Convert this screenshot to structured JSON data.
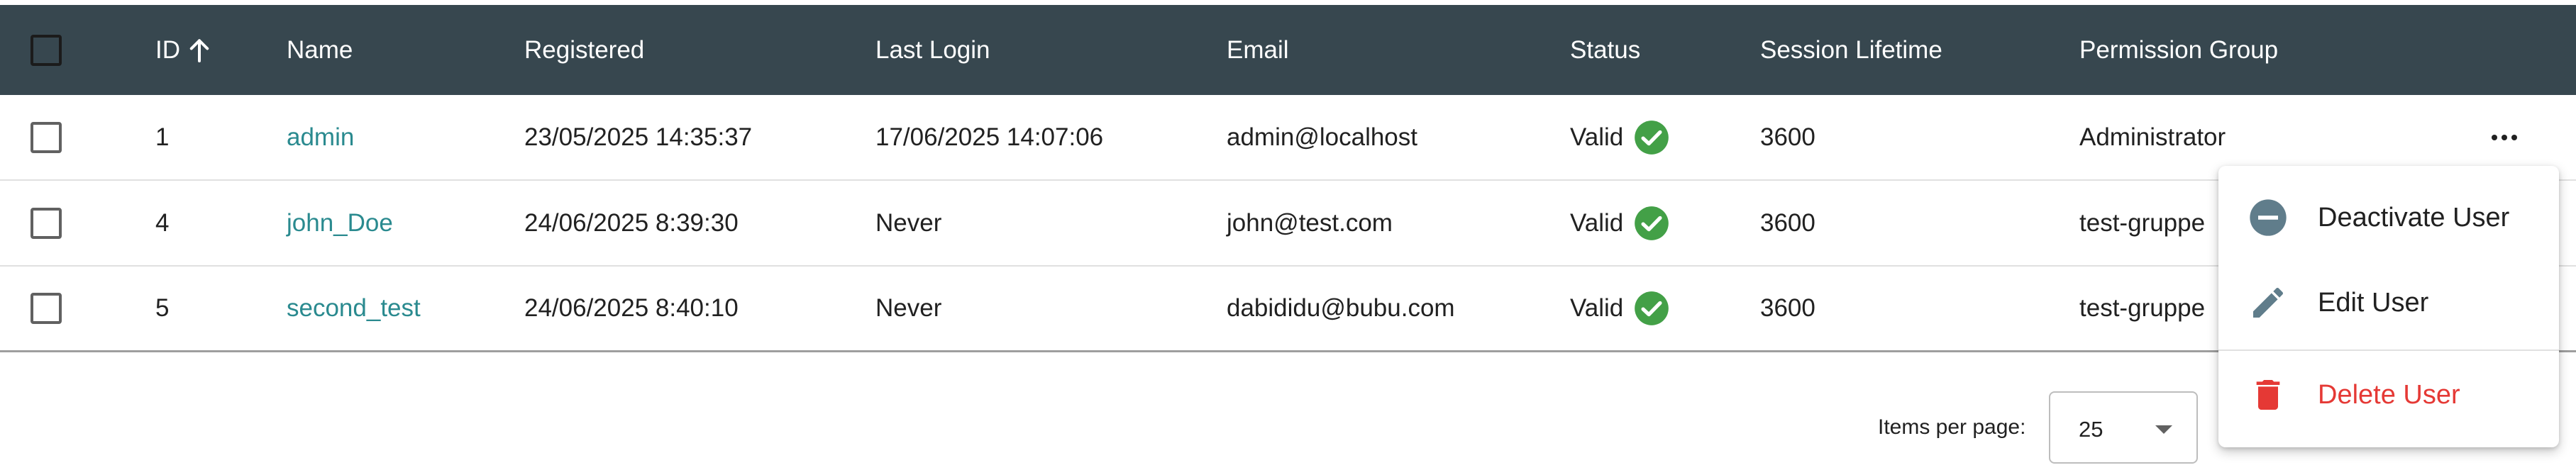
{
  "table": {
    "headers": {
      "id": "ID",
      "name": "Name",
      "registered": "Registered",
      "last_login": "Last Login",
      "email": "Email",
      "status": "Status",
      "session_lifetime": "Session Lifetime",
      "permission_group": "Permission Group"
    },
    "sort": {
      "column": "ID",
      "direction": "ascending",
      "icon": "arrow-up-icon"
    },
    "rows": [
      {
        "id": "1",
        "name": "admin",
        "registered": "23/05/2025 14:35:37",
        "last_login": "17/06/2025 14:07:06",
        "email": "admin@localhost",
        "status": "Valid",
        "session_lifetime": "3600",
        "permission_group": "Administrator"
      },
      {
        "id": "4",
        "name": "john_Doe",
        "registered": "24/06/2025 8:39:30",
        "last_login": "Never",
        "email": "john@test.com",
        "status": "Valid",
        "session_lifetime": "3600",
        "permission_group": "test-gruppe"
      },
      {
        "id": "5",
        "name": "second_test",
        "registered": "24/06/2025 8:40:10",
        "last_login": "Never",
        "email": "dabididu@bubu.com",
        "status": "Valid",
        "session_lifetime": "3600",
        "permission_group": "test-gruppe"
      }
    ]
  },
  "paginator": {
    "label": "Items per page:",
    "page_size": "25"
  },
  "context_menu": {
    "items": [
      {
        "label": "Deactivate User",
        "icon": "minus-circle-icon"
      },
      {
        "label": "Edit User",
        "icon": "pencil-icon"
      },
      {
        "label": "Delete User",
        "icon": "trash-icon"
      }
    ]
  },
  "colors": {
    "header_bg": "#37474f",
    "link": "#2a8a8f",
    "valid": "#43a047",
    "danger": "#e53935",
    "icon_grey": "#607d8b"
  }
}
